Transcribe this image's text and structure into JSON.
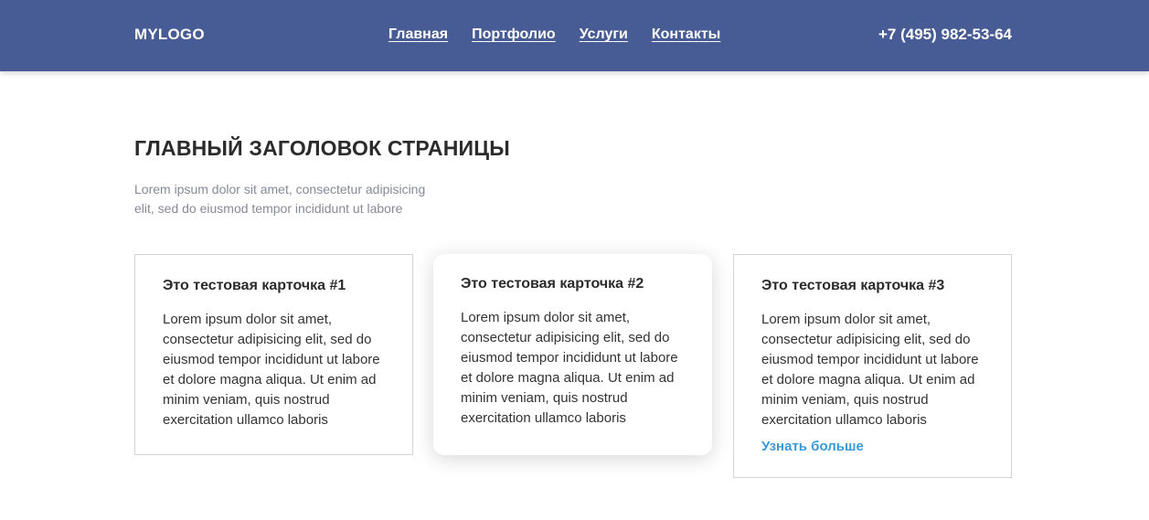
{
  "header": {
    "logo": "MYLOGO",
    "nav": [
      "Главная",
      "Портфолио",
      "Услуги",
      "Контакты"
    ],
    "phone": "+7 (495) 982-53-64",
    "background": "#475b94"
  },
  "main": {
    "title": "ГЛАВНЫЙ ЗАГОЛОВОК СТРАНИЦЫ",
    "description": "Lorem ipsum dolor sit amet, consectetur adipisicing elit, sed do eiusmod tempor incididunt ut labore"
  },
  "cards": [
    {
      "title": "Это тестовая карточка #1",
      "text": "Lorem ipsum dolor sit amet, consectetur adipisicing elit, sed do eiusmod tempor incididunt ut labore et dolore magna aliqua. Ut enim ad minim veniam, quis nostrud exercitation ullamco laboris"
    },
    {
      "title": "Это тестовая карточка #2",
      "text": "Lorem ipsum dolor sit amet, consectetur adipisicing elit, sed do eiusmod tempor incididunt ut labore et dolore magna aliqua. Ut enim ad minim veniam, quis nostrud exercitation ullamco laboris"
    },
    {
      "title": "Это тестовая карточка #3",
      "text": "Lorem ipsum dolor sit amet, consectetur adipisicing elit, sed do eiusmod tempor incididunt ut labore et dolore magna aliqua. Ut enim ad minim veniam, quis nostrud exercitation ullamco laboris",
      "link": "Узнать больше"
    }
  ],
  "colors": {
    "accent_link": "#3a9ad9",
    "title_text": "#2b2b2b",
    "muted_text": "#858a96"
  }
}
